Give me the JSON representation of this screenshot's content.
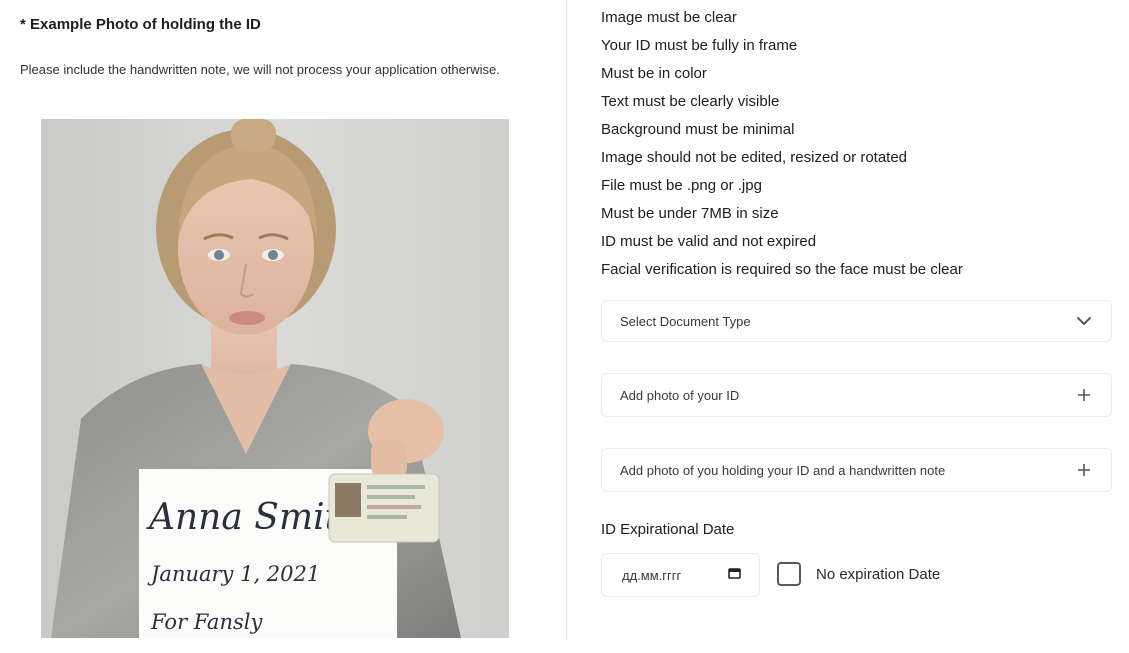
{
  "example": {
    "title": "* Example Photo of holding the ID",
    "note": "Please include the handwritten note, we will not process your application otherwise.",
    "photo_note": {
      "name": "Anna Smith",
      "date": "January 1, 2021",
      "line3": "For Fansly"
    }
  },
  "requirements": [
    "Image must be clear",
    "Your ID must be fully in frame",
    "Must be in color",
    "Text must be clearly visible",
    "Background must be minimal",
    "Image should not be edited, resized or rotated",
    "File must be .png or .jpg",
    "Must be under 7MB in size",
    "ID must be valid and not expired",
    "Facial verification is required so the face must be clear"
  ],
  "form": {
    "document_type": {
      "label": "Select Document Type",
      "icon": "chevron-down-icon"
    },
    "id_photo": {
      "label": "Add photo of your ID",
      "icon": "plus-icon"
    },
    "holding_photo": {
      "label": "Add photo of you holding your ID and a handwritten note",
      "icon": "plus-icon"
    },
    "expiration": {
      "label": "ID Expirational Date",
      "placeholder": "дд.мм.гггг",
      "icon": "calendar-icon",
      "no_expiration_label": "No expiration Date",
      "no_expiration_checked": false
    }
  }
}
